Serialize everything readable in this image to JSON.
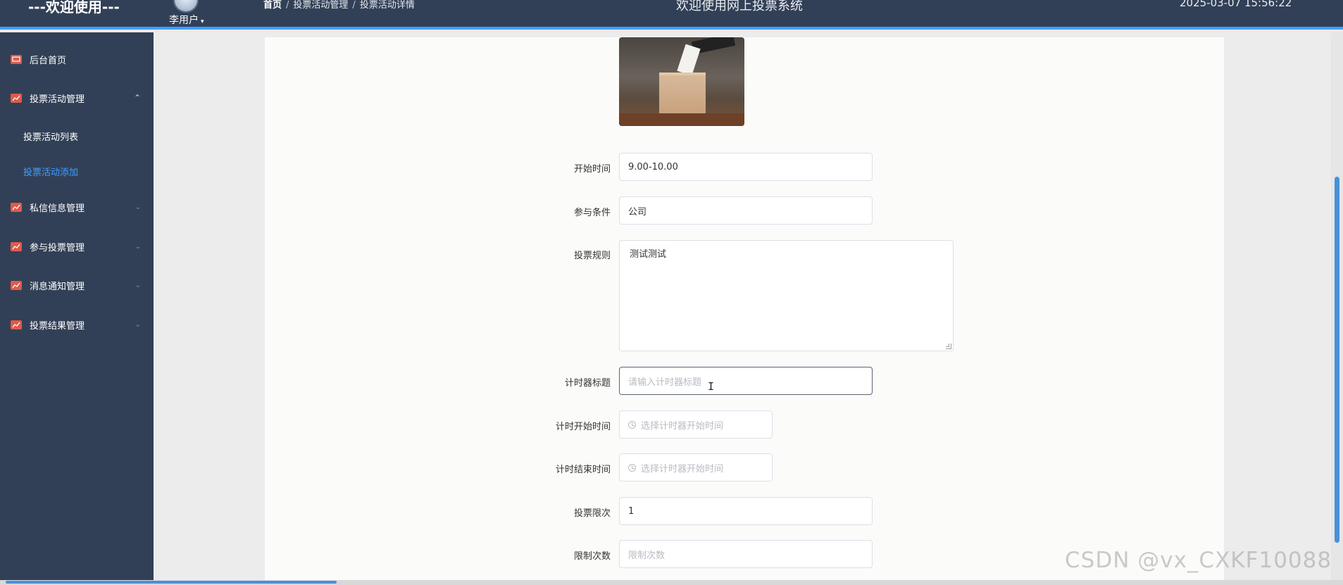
{
  "header": {
    "brand": "---欢迎使用---",
    "username": "李用户",
    "breadcrumb": [
      "首页",
      "投票活动管理",
      "投票活动详情"
    ],
    "system_title": "欢迎使用网上投票系统",
    "datetime": "2025-03-07 15:56:22"
  },
  "sidebar": {
    "items": [
      {
        "label": "后台首页",
        "icon": "monitor-icon"
      },
      {
        "label": "投票活动管理",
        "icon": "chart-icon",
        "expanded": true
      },
      {
        "label": "私信信息管理",
        "icon": "chart-icon"
      },
      {
        "label": "参与投票管理",
        "icon": "chart-icon"
      },
      {
        "label": "消息通知管理",
        "icon": "chart-icon"
      },
      {
        "label": "投票结果管理",
        "icon": "chart-icon"
      }
    ],
    "submenu": [
      {
        "label": "投票活动列表",
        "active": false
      },
      {
        "label": "投票活动添加",
        "active": true
      }
    ]
  },
  "form": {
    "start_time": {
      "label": "开始时间",
      "value": "9.00-10.00"
    },
    "condition": {
      "label": "参与条件",
      "value": "公司"
    },
    "rules": {
      "label": "投票规则",
      "value": "测试测试"
    },
    "timer_title": {
      "label": "计时器标题",
      "placeholder": "请输入计时器标题"
    },
    "timer_start": {
      "label": "计时开始时间",
      "placeholder": "选择计时器开始时间"
    },
    "timer_end": {
      "label": "计时结束时间",
      "placeholder": "选择计时器开始时间"
    },
    "vote_limit": {
      "label": "投票限次",
      "value": "1"
    },
    "limit_count": {
      "label": "限制次数",
      "placeholder": "限制次数"
    }
  },
  "watermark": "CSDN @vx_CXKF10088",
  "colors": {
    "header_bg": "#324057",
    "sidebar_bg": "#324057",
    "accent": "#409eff",
    "icon_red": "#e05a4b"
  }
}
